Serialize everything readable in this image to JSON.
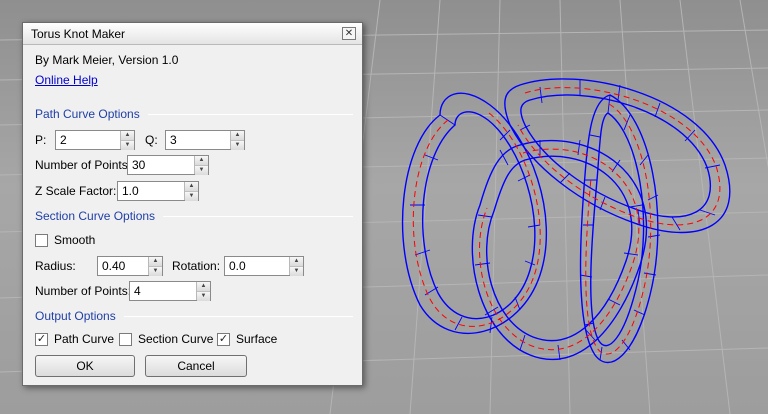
{
  "dialog": {
    "title": "Torus Knot Maker",
    "close_icon": "close-icon",
    "author": "By Mark Meier, Version 1.0",
    "help_link": "Online Help",
    "path_section": "Path Curve Options",
    "p_label": "P:",
    "p_value": "2",
    "q_label": "Q:",
    "q_value": "3",
    "path_points_label": "Number of Points:",
    "path_points_value": "30",
    "z_scale_label": "Z Scale Factor:",
    "z_scale_value": "1.0",
    "section_section": "Section Curve Options",
    "smooth_label": "Smooth",
    "smooth_checked": false,
    "radius_label": "Radius:",
    "radius_value": "0.40",
    "rotation_label": "Rotation:",
    "rotation_value": "0.0",
    "section_points_label": "Number of Points:",
    "section_points_value": "4",
    "output_section": "Output Options",
    "path_curve_label": "Path Curve",
    "path_curve_checked": true,
    "section_curve_label": "Section Curve",
    "section_curve_checked": false,
    "surface_label": "Surface",
    "surface_checked": true,
    "ok_label": "OK",
    "cancel_label": "Cancel"
  },
  "colors": {
    "wire": "#0000ff",
    "path_curve": "#ff0000",
    "section_heading": "#1f3fa8"
  }
}
